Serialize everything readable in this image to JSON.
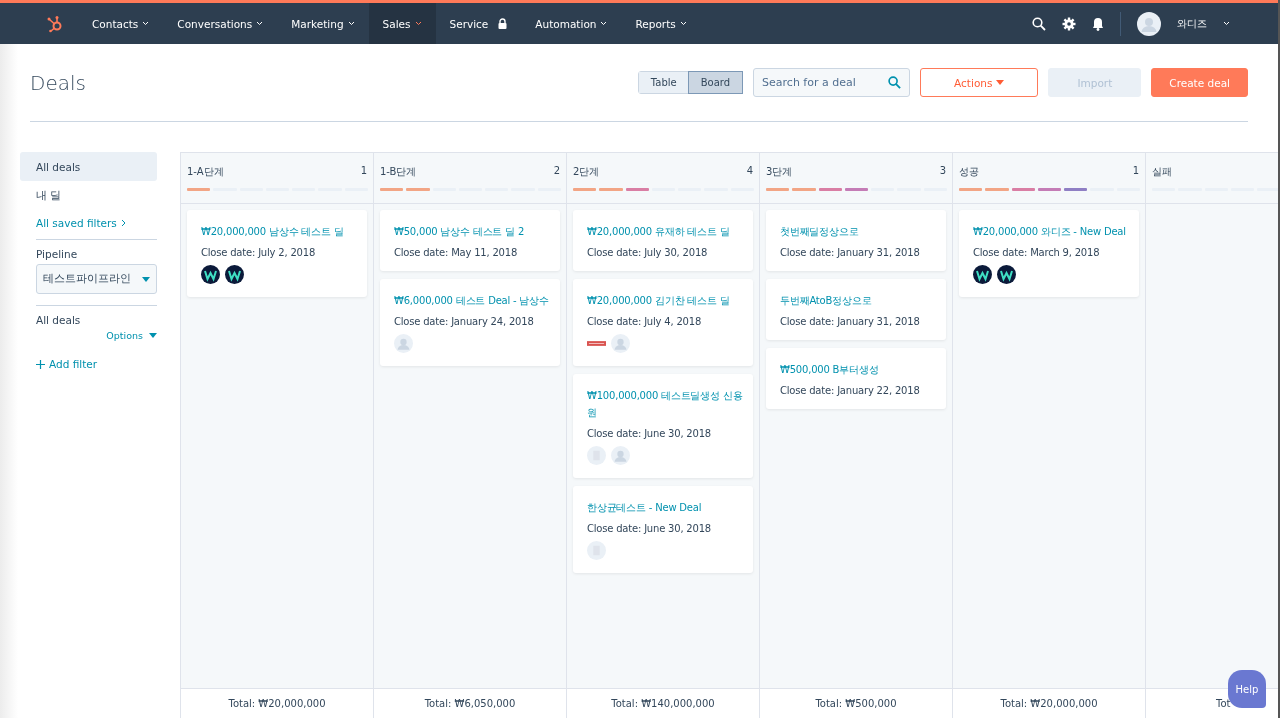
{
  "nav": {
    "items": [
      {
        "label": "Contacts",
        "kind": "menu",
        "selected": false
      },
      {
        "label": "Conversations",
        "kind": "menu",
        "selected": false
      },
      {
        "label": "Marketing",
        "kind": "menu",
        "selected": false
      },
      {
        "label": "Sales",
        "kind": "menu",
        "selected": true
      },
      {
        "label": "Service",
        "kind": "locked",
        "selected": false
      },
      {
        "label": "Automation",
        "kind": "menu",
        "selected": false
      },
      {
        "label": "Reports",
        "kind": "menu",
        "selected": false
      }
    ],
    "user": "와디즈"
  },
  "page": {
    "title": "Deals",
    "views": [
      {
        "label": "Table",
        "selected": false
      },
      {
        "label": "Board",
        "selected": true
      }
    ],
    "search": {
      "placeholder": "Search for a deal"
    },
    "actions": "Actions",
    "import": {
      "label": "Import",
      "disabled": true
    },
    "create": "Create deal"
  },
  "sidebar": {
    "views": [
      {
        "label": "All deals",
        "selected": true
      },
      {
        "label": "내 딜",
        "selected": false
      }
    ],
    "saved_filters": "All saved filters",
    "pipeline_label": "Pipeline",
    "pipeline": "테스트파이프라인",
    "filter_title": "All deals",
    "options": "Options",
    "add_filter": "Add filter"
  },
  "board": {
    "columns": [
      {
        "name": "1-A단계",
        "count": "1",
        "stages": [
          {
            "filled": true
          },
          {
            "filled": false
          },
          {
            "filled": false
          },
          {
            "filled": false
          },
          {
            "filled": false
          },
          {
            "filled": false
          },
          {
            "filled": false
          }
        ],
        "total": "Total: ₩20,000,000",
        "cards": [
          {
            "title": "₩20,000,000 남상수 테스트 딜",
            "date_label": "Close date:",
            "date": "July 2, 2018",
            "avatars": [
              {
                "kind": "logo"
              },
              {
                "kind": "logo"
              }
            ]
          }
        ]
      },
      {
        "name": "1-B단계",
        "count": "2",
        "stages": [
          {
            "filled": true
          },
          {
            "filled": true
          },
          {
            "filled": false
          },
          {
            "filled": false
          },
          {
            "filled": false
          },
          {
            "filled": false
          },
          {
            "filled": false
          }
        ],
        "total": "Total: ₩6,050,000",
        "cards": [
          {
            "title": "₩50,000 남상수 테스트 딜 2",
            "date_label": "Close date:",
            "date": "May 11, 2018"
          },
          {
            "title": "₩6,000,000 테스트 Deal - 남상수",
            "date_label": "Close date:",
            "date": "January 24, 2018",
            "avatars": [
              {
                "kind": "person"
              }
            ]
          }
        ]
      },
      {
        "name": "2단계",
        "count": "4",
        "stages": [
          {
            "filled": true
          },
          {
            "filled": true
          },
          {
            "filled": true
          },
          {
            "filled": false
          },
          {
            "filled": false
          },
          {
            "filled": false
          },
          {
            "filled": false
          }
        ],
        "total": "Total: ₩140,000,000",
        "cards": [
          {
            "title": "₩20,000,000 유재하 테스트 딜",
            "date_label": "Close date:",
            "date": "July 30, 2018"
          },
          {
            "title": "₩20,000,000 김기찬 테스트 딜",
            "date_label": "Close date:",
            "date": "July 4, 2018",
            "avatars": [
              {
                "kind": "image"
              },
              {
                "kind": "person"
              }
            ]
          },
          {
            "title": "₩100,000,000 테스트딜생성 신용원",
            "date_label": "Close date:",
            "date": "June 30, 2018",
            "avatars": [
              {
                "kind": "company"
              },
              {
                "kind": "person"
              }
            ]
          },
          {
            "title": "한상균테스트 - New Deal",
            "date_label": "Close date:",
            "date": "June 30, 2018",
            "avatars": [
              {
                "kind": "company"
              }
            ]
          }
        ]
      },
      {
        "name": "3단계",
        "count": "3",
        "stages": [
          {
            "filled": true
          },
          {
            "filled": true
          },
          {
            "filled": true
          },
          {
            "filled": true
          },
          {
            "filled": false
          },
          {
            "filled": false
          },
          {
            "filled": false
          }
        ],
        "total": "Total: ₩500,000",
        "cards": [
          {
            "title": "첫번째딜정상으로",
            "date_label": "Close date:",
            "date": "January 31, 2018"
          },
          {
            "title": "두번째AtoB정상으로",
            "date_label": "Close date:",
            "date": "January 31, 2018"
          },
          {
            "title": "₩500,000 B부터생성",
            "date_label": "Close date:",
            "date": "January 22, 2018"
          }
        ]
      },
      {
        "name": "성공",
        "count": "1",
        "stages": [
          {
            "filled": true
          },
          {
            "filled": true
          },
          {
            "filled": true
          },
          {
            "filled": true
          },
          {
            "filled": true
          },
          {
            "filled": false
          },
          {
            "filled": false
          }
        ],
        "total": "Total: ₩20,000,000",
        "cards": [
          {
            "title": "₩20,000,000 와디즈 - New Deal",
            "date_label": "Close date:",
            "date": "March 9, 2018",
            "avatars": [
              {
                "kind": "logo"
              },
              {
                "kind": "logo"
              }
            ]
          }
        ]
      },
      {
        "name": "실패",
        "stages": [
          {
            "filled": false
          },
          {
            "filled": false
          },
          {
            "filled": false
          },
          {
            "filled": false
          },
          {
            "filled": false
          }
        ],
        "total": "Tot"
      }
    ]
  },
  "help": "Help"
}
